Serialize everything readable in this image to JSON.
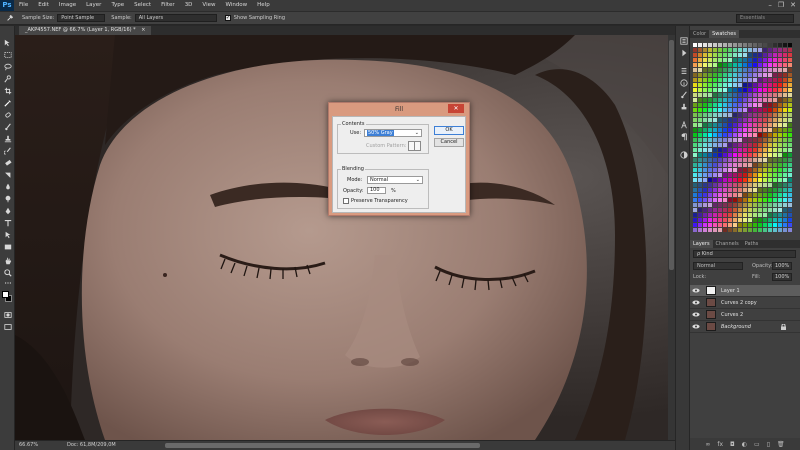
{
  "app": {
    "logo": "Ps"
  },
  "menu": [
    "File",
    "Edit",
    "Image",
    "Layer",
    "Type",
    "Select",
    "Filter",
    "3D",
    "View",
    "Window",
    "Help"
  ],
  "window_controls": {
    "minimize": "–",
    "maximize": "❐",
    "close": "✕"
  },
  "options": {
    "sample_size_label": "Sample Size:",
    "sample_size_value": "Point Sample",
    "sample_label": "Sample:",
    "sample_value": "All Layers",
    "ring_checked": "✓",
    "ring_label": "Show Sampling Ring",
    "workspace": "Essentials"
  },
  "document": {
    "tab": "_AKP4557.NEF @ 66.7% (Layer 1, RGB/16) *",
    "tab_close": "×"
  },
  "status": {
    "zoom": "66.67%",
    "doc": "Doc: 61,8M/209,0M"
  },
  "right_panel": {
    "swatch_tabs": [
      "Color",
      "Swatches"
    ],
    "layer_tabs": [
      "Layers",
      "Channels",
      "Paths"
    ],
    "filter_kind": "ρ Kind",
    "blend_mode": "Normal",
    "opacity_label": "Opacity:",
    "opacity_value": "100%",
    "lock_label": "Lock:",
    "fill_label": "Fill:",
    "fill_value": "100%",
    "bottom_icons": [
      "∞",
      "fx",
      "◘",
      "◐",
      "▭",
      "▯",
      "🗑"
    ]
  },
  "layers": [
    {
      "name": "Layer 1",
      "selected": true,
      "thumb": "#f2f2f2"
    },
    {
      "name": "Curves 2 copy",
      "selected": false,
      "thumb": "#6b4a44"
    },
    {
      "name": "Curves 2",
      "selected": false,
      "thumb": "#6b4a44"
    },
    {
      "name": "Background",
      "selected": false,
      "thumb": "#6b4a44"
    }
  ],
  "dialog": {
    "title": "Fill",
    "close": "✕",
    "contents_title": "Contents",
    "use_label": "Use:",
    "use_value": "50% Gray",
    "custom_pattern_label": "Custom Pattern:",
    "blending_title": "Blending",
    "mode_label": "Mode:",
    "mode_value": "Normal",
    "opacity_label": "Opacity:",
    "opacity_value": "100",
    "percent": "%",
    "preserve_label": "Preserve Transparency",
    "ok": "OK",
    "cancel": "Cancel"
  },
  "colors": {
    "dialog_frame": "#d99a7f",
    "close_button": "#c74435",
    "selection_blue": "#3d7fd6"
  }
}
